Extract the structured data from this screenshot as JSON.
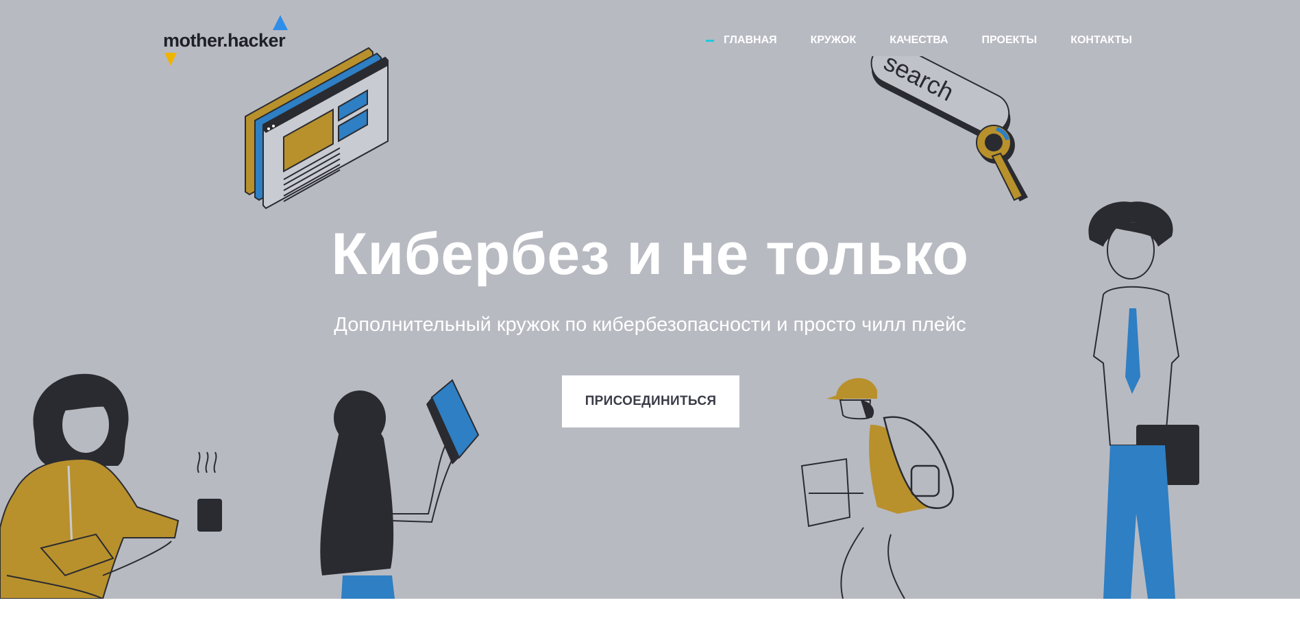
{
  "header": {
    "logo_text": "mother.hacker",
    "nav": [
      {
        "label": "ГЛАВНАЯ",
        "active": true
      },
      {
        "label": "КРУЖОК",
        "active": false
      },
      {
        "label": "КАЧЕСТВА",
        "active": false
      },
      {
        "label": "ПРОЕКТЫ",
        "active": false
      },
      {
        "label": "КОНТАКТЫ",
        "active": false
      }
    ]
  },
  "hero": {
    "title": "Кибербез и не только",
    "subtitle": "Дополнительный кружок по кибербезопасности и просто чилл плейс",
    "cta_label": "ПРИСОЕДИНИТЬСЯ",
    "search_illustration_text": "search"
  },
  "colors": {
    "hero_background": "#b8bac2",
    "accent_blue": "#2e7fc4",
    "accent_mustard": "#b8912c",
    "dark": "#2a2b30",
    "nav_active_marker": "#1fc8e0"
  },
  "icons": {
    "logo_up": "triangle-up-icon",
    "logo_down": "triangle-down-icon"
  }
}
